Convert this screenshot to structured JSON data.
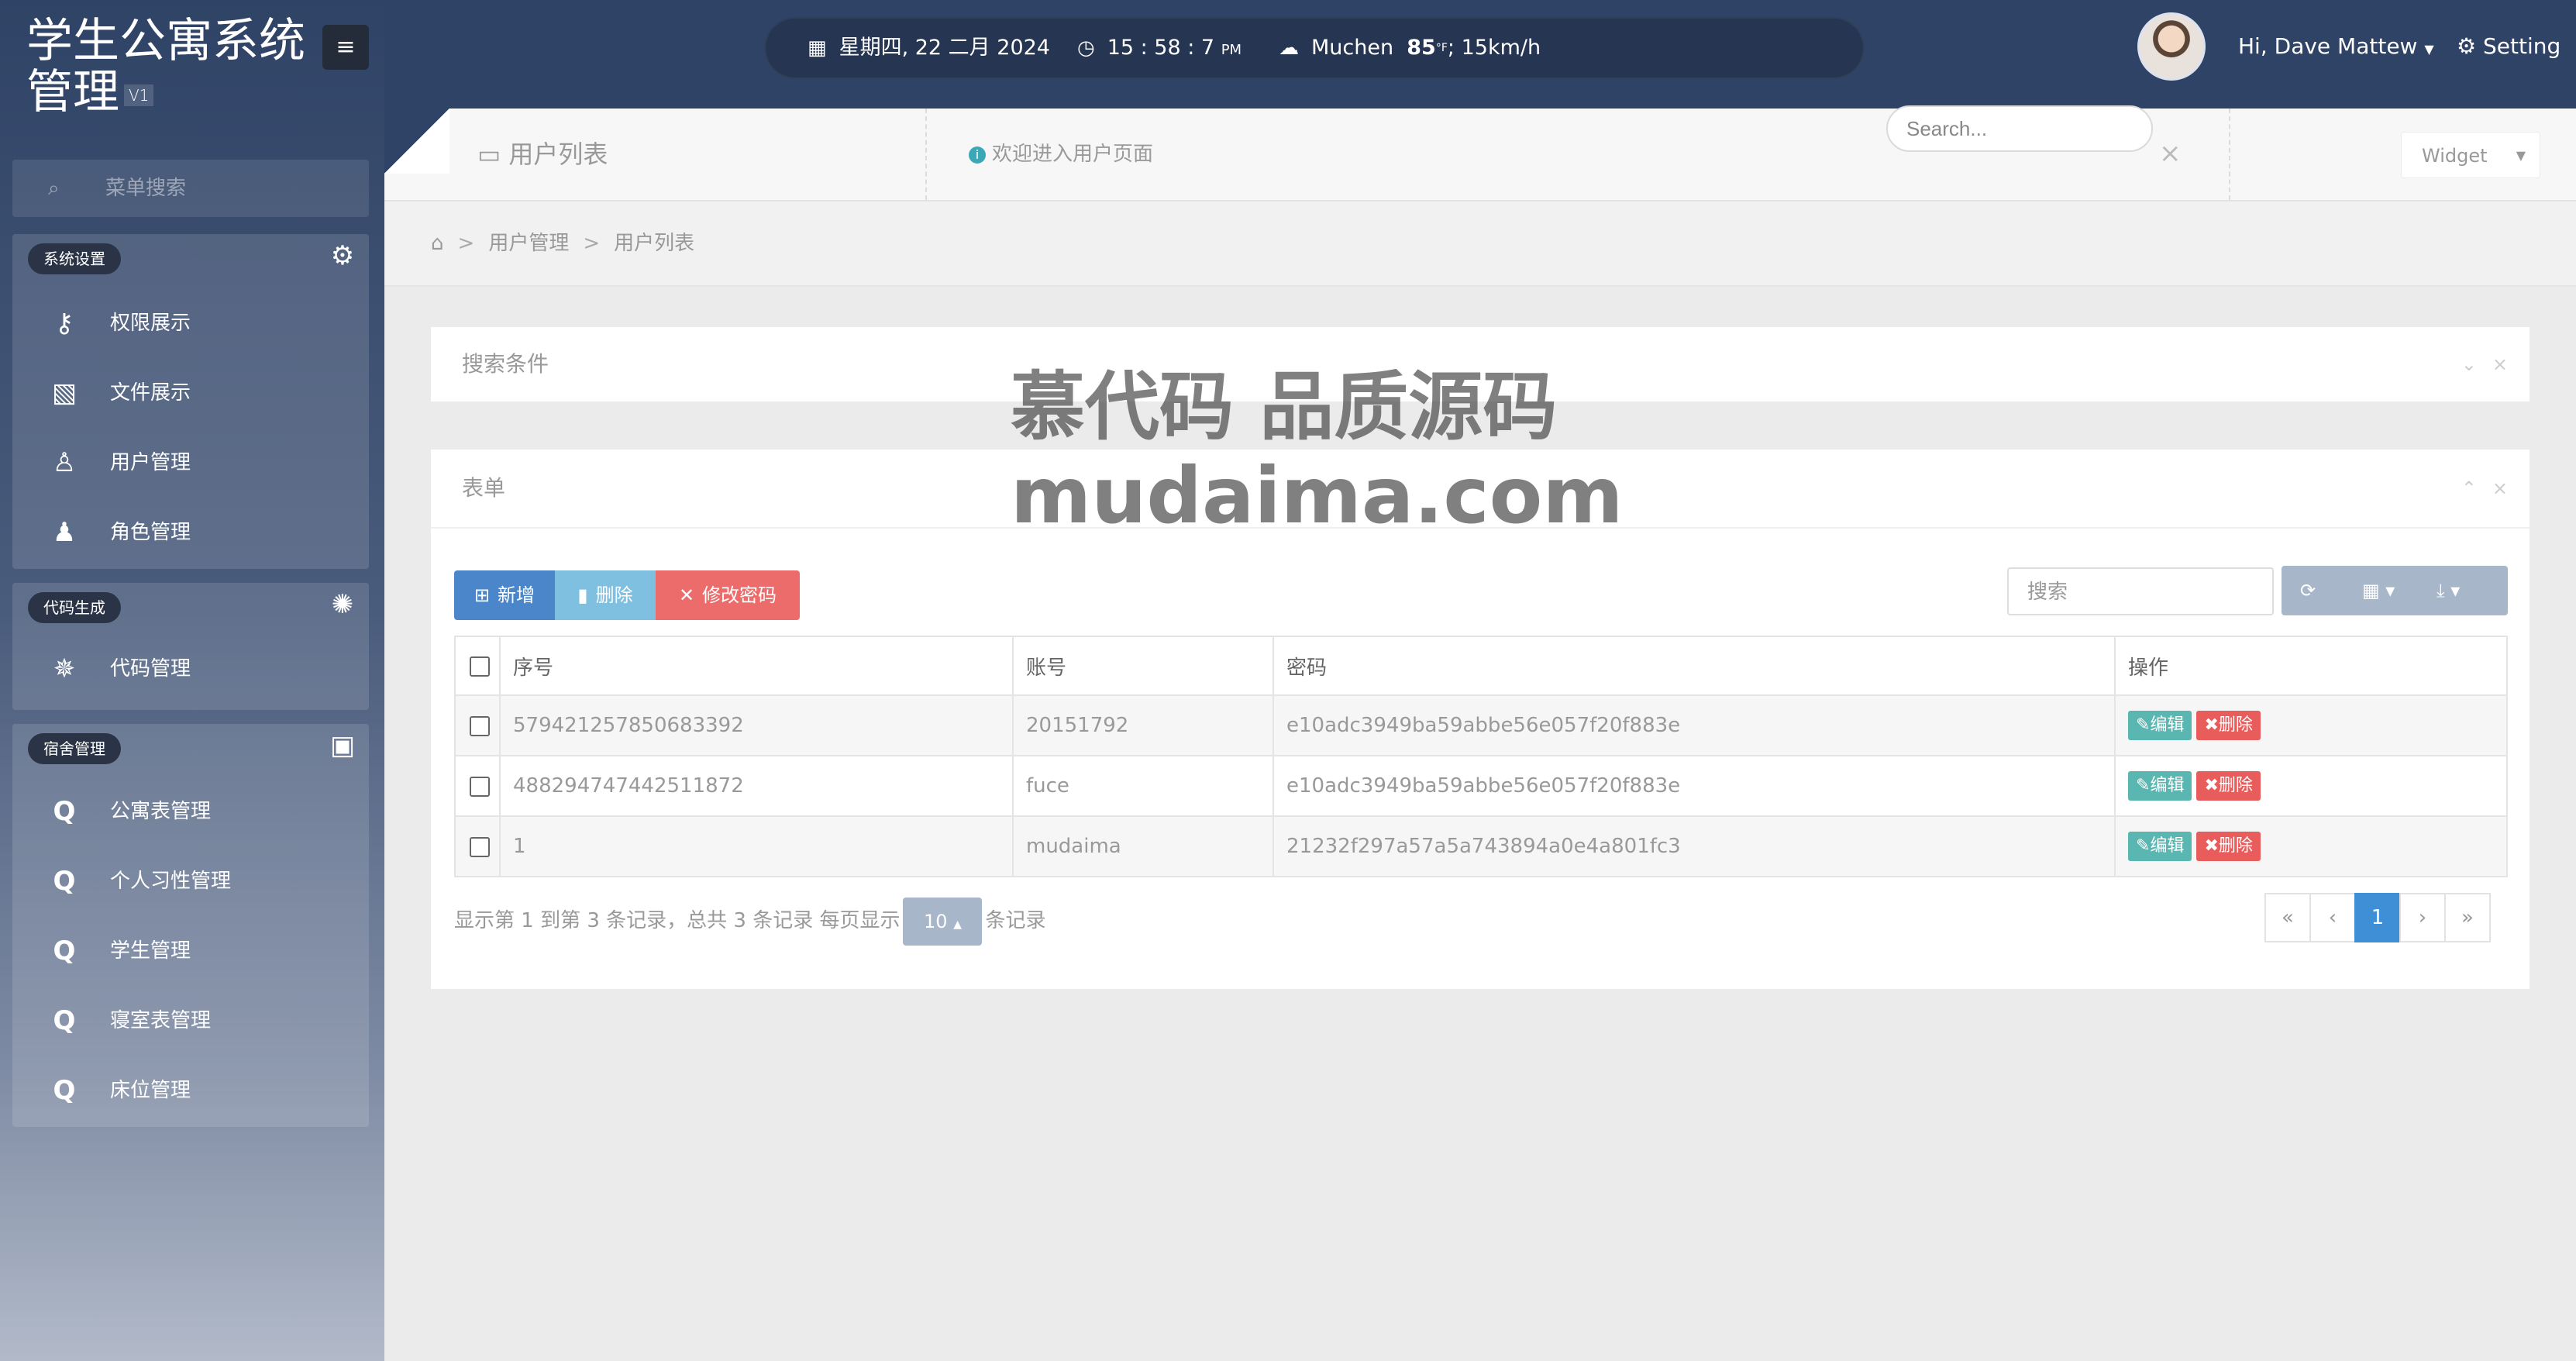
{
  "app": {
    "title": "学生公寓系统管理",
    "version": "V1",
    "menu_toggle": "≡"
  },
  "sidebar": {
    "search_label": "菜单搜索",
    "groups": [
      {
        "tag": "系统设置",
        "tool_icon": "gear-icon",
        "items": [
          {
            "label": "权限展示",
            "icon": "key-icon"
          },
          {
            "label": "文件展示",
            "icon": "image-icon"
          },
          {
            "label": "用户管理",
            "icon": "user-icon"
          },
          {
            "label": "角色管理",
            "icon": "users-icon"
          }
        ]
      },
      {
        "tag": "代码生成",
        "tool_icon": "rebel-icon",
        "items": [
          {
            "label": "代码管理",
            "icon": "bug-icon"
          }
        ]
      },
      {
        "tag": "宿舍管理",
        "tool_icon": "contact-card-icon",
        "items": [
          {
            "label": "公寓表管理",
            "icon": "q-icon"
          },
          {
            "label": "个人习性管理",
            "icon": "q-icon"
          },
          {
            "label": "学生管理",
            "icon": "q-icon"
          },
          {
            "label": "寝室表管理",
            "icon": "q-icon"
          },
          {
            "label": "床位管理",
            "icon": "q-icon"
          }
        ]
      }
    ]
  },
  "topbar": {
    "date": "星期四, 22 二月 2024",
    "time": "15 : 58 : 7",
    "time_suffix": "PM",
    "city": "Muchen",
    "temperature": "85",
    "temp_unit": "°F",
    "wind": "; 15km/h",
    "user_greeting": "Hi, Dave Mattew",
    "setting_label": "Setting"
  },
  "tabbar": {
    "page_title": "用户列表",
    "welcome": "欢迎进入用户页面",
    "close": "×",
    "widget_label": "Widget"
  },
  "breadcrumb": {
    "items": [
      "用户管理",
      "用户列表"
    ],
    "separator": ">"
  },
  "global_search": {
    "placeholder": "Search..."
  },
  "search_panel": {
    "title": "搜索条件"
  },
  "table_panel": {
    "title": "表单",
    "buttons": {
      "add": "新增",
      "delete": "删除",
      "change_password": "修改密码"
    },
    "search_placeholder": "搜索",
    "columns": [
      "序号",
      "账号",
      "密码",
      "操作"
    ],
    "rows": [
      {
        "id": "579421257850683392",
        "account": "20151792",
        "password": "e10adc3949ba59abbe56e057f20f883e"
      },
      {
        "id": "488294747442511872",
        "account": "fuce",
        "password": "e10adc3949ba59abbe56e057f20f883e"
      },
      {
        "id": "1",
        "account": "mudaima",
        "password": "21232f297a57a5a743894a0e4a801fc3"
      }
    ],
    "row_actions": {
      "edit": "编辑",
      "delete": "删除"
    },
    "footer": {
      "info": "显示第 1 到第 3 条记录，总共 3 条记录 每页显示",
      "page_size": "10",
      "suffix": "条记录"
    },
    "pager": [
      "«",
      "‹",
      "1",
      "›",
      "»"
    ],
    "current_page": "1"
  },
  "watermark": {
    "line1": "慕代码 品质源码",
    "line2": "mudaima.com"
  }
}
